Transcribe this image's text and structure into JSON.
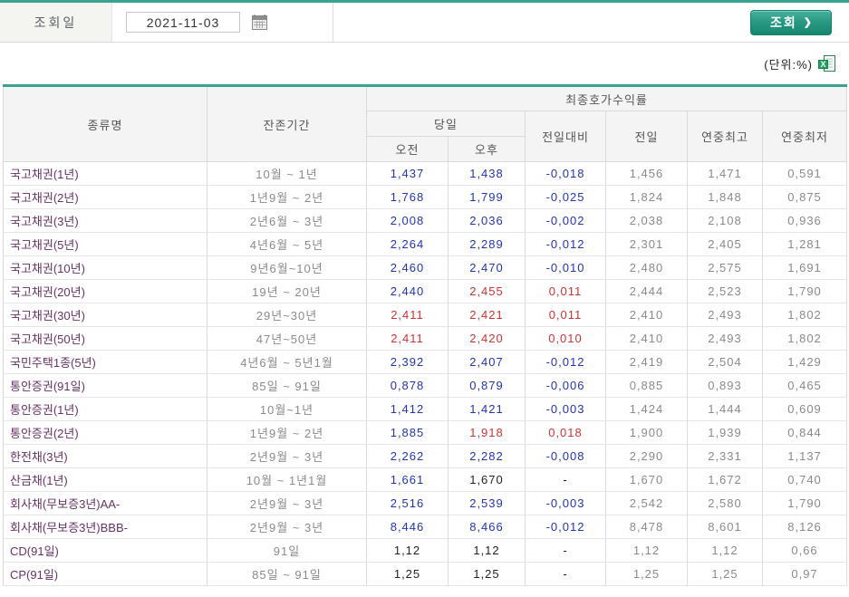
{
  "colors": {
    "teal": "#3aa390",
    "blue": "#2434ab",
    "red": "#cc3333",
    "gray": "#8a8a8a",
    "black": "#222222",
    "purple": "#663366"
  },
  "topbar": {
    "date_label": "조회일",
    "date_value": "2021-11-03",
    "calendar_icon": "calendar-icon",
    "search_button": "조회",
    "search_arrow": "❯"
  },
  "unit_label": "(단위:%)",
  "excel_icon": "excel-download-icon",
  "table": {
    "headers": {
      "name": "종류명",
      "term": "잔존기간",
      "yield_group": "최종호가수익률",
      "today": "당일",
      "am": "오전",
      "pm": "오후",
      "vs_prev": "전일대비",
      "prev": "전일",
      "year_high": "연중최고",
      "year_low": "연중최저"
    },
    "rows": [
      {
        "name": "국고채권(1년)",
        "term": "10월 ~ 1년",
        "am": "1,437",
        "am_color": "blue",
        "pm": "1,438",
        "pm_color": "blue",
        "change": "-0,018",
        "change_color": "blue",
        "prev": "1,456",
        "high": "1,471",
        "low": "0,591",
        "group_start": false
      },
      {
        "name": "국고채권(2년)",
        "term": "1년9월 ~ 2년",
        "am": "1,768",
        "am_color": "blue",
        "pm": "1,799",
        "pm_color": "blue",
        "change": "-0,025",
        "change_color": "blue",
        "prev": "1,824",
        "high": "1,848",
        "low": "0,875",
        "group_start": false
      },
      {
        "name": "국고채권(3년)",
        "term": "2년6월 ~ 3년",
        "am": "2,008",
        "am_color": "blue",
        "pm": "2,036",
        "pm_color": "blue",
        "change": "-0,002",
        "change_color": "blue",
        "prev": "2,038",
        "high": "2,108",
        "low": "0,936",
        "group_start": false
      },
      {
        "name": "국고채권(5년)",
        "term": "4년6월 ~ 5년",
        "am": "2,264",
        "am_color": "blue",
        "pm": "2,289",
        "pm_color": "blue",
        "change": "-0,012",
        "change_color": "blue",
        "prev": "2,301",
        "high": "2,405",
        "low": "1,281",
        "group_start": false
      },
      {
        "name": "국고채권(10년)",
        "term": "9년6월~10년",
        "am": "2,460",
        "am_color": "blue",
        "pm": "2,470",
        "pm_color": "blue",
        "change": "-0,010",
        "change_color": "blue",
        "prev": "2,480",
        "high": "2,575",
        "low": "1,691",
        "group_start": false
      },
      {
        "name": "국고채권(20년)",
        "term": "19년 ~ 20년",
        "am": "2,440",
        "am_color": "blue",
        "pm": "2,455",
        "pm_color": "red",
        "change": "0,011",
        "change_color": "red",
        "prev": "2,444",
        "high": "2,523",
        "low": "1,790",
        "group_start": false
      },
      {
        "name": "국고채권(30년)",
        "term": "29년~30년",
        "am": "2,411",
        "am_color": "red",
        "pm": "2,421",
        "pm_color": "red",
        "change": "0,011",
        "change_color": "red",
        "prev": "2,410",
        "high": "2,493",
        "low": "1,802",
        "group_start": false
      },
      {
        "name": "국고채권(50년)",
        "term": "47년~50년",
        "am": "2,411",
        "am_color": "red",
        "pm": "2,420",
        "pm_color": "red",
        "change": "0,010",
        "change_color": "red",
        "prev": "2,410",
        "high": "2,493",
        "low": "1,802",
        "group_start": false
      },
      {
        "name": "국민주택1종(5년)",
        "term": "4년6월 ~ 5년1월",
        "am": "2,392",
        "am_color": "blue",
        "pm": "2,407",
        "pm_color": "blue",
        "change": "-0,012",
        "change_color": "blue",
        "prev": "2,419",
        "high": "2,504",
        "low": "1,429",
        "group_start": false
      },
      {
        "name": "통안증권(91일)",
        "term": "85일 ~ 91일",
        "am": "0,878",
        "am_color": "blue",
        "pm": "0,879",
        "pm_color": "blue",
        "change": "-0,006",
        "change_color": "blue",
        "prev": "0,885",
        "high": "0,893",
        "low": "0,465",
        "group_start": true
      },
      {
        "name": "통안증권(1년)",
        "term": "10월~1년",
        "am": "1,412",
        "am_color": "blue",
        "pm": "1,421",
        "pm_color": "blue",
        "change": "-0,003",
        "change_color": "blue",
        "prev": "1,424",
        "high": "1,444",
        "low": "0,609",
        "group_start": false
      },
      {
        "name": "통안증권(2년)",
        "term": "1년9월 ~ 2년",
        "am": "1,885",
        "am_color": "blue",
        "pm": "1,918",
        "pm_color": "red",
        "change": "0,018",
        "change_color": "red",
        "prev": "1,900",
        "high": "1,939",
        "low": "0,844",
        "group_start": false
      },
      {
        "name": "한전채(3년)",
        "term": "2년9월 ~ 3년",
        "am": "2,262",
        "am_color": "blue",
        "pm": "2,282",
        "pm_color": "blue",
        "change": "-0,008",
        "change_color": "blue",
        "prev": "2,290",
        "high": "2,331",
        "low": "1,137",
        "group_start": true
      },
      {
        "name": "산금채(1년)",
        "term": "10월 ~ 1년1월",
        "am": "1,661",
        "am_color": "blue",
        "pm": "1,670",
        "pm_color": "black",
        "change": "-",
        "change_color": "black",
        "prev": "1,670",
        "high": "1,672",
        "low": "0,740",
        "group_start": false
      },
      {
        "name": "회사채(무보증3년)AA-",
        "term": "2년9월 ~ 3년",
        "am": "2,516",
        "am_color": "blue",
        "pm": "2,539",
        "pm_color": "blue",
        "change": "-0,003",
        "change_color": "blue",
        "prev": "2,542",
        "high": "2,580",
        "low": "1,790",
        "group_start": true
      },
      {
        "name": "회사채(무보증3년)BBB-",
        "term": "2년9월 ~ 3년",
        "am": "8,446",
        "am_color": "blue",
        "pm": "8,466",
        "pm_color": "blue",
        "change": "-0,012",
        "change_color": "blue",
        "prev": "8,478",
        "high": "8,601",
        "low": "8,126",
        "group_start": false
      },
      {
        "name": "CD(91일)",
        "term": "91일",
        "am": "1,12",
        "am_color": "black",
        "pm": "1,12",
        "pm_color": "black",
        "change": "-",
        "change_color": "black",
        "prev": "1,12",
        "high": "1,12",
        "low": "0,66",
        "group_start": true
      },
      {
        "name": "CP(91일)",
        "term": "85일 ~ 91일",
        "am": "1,25",
        "am_color": "black",
        "pm": "1,25",
        "pm_color": "black",
        "change": "-",
        "change_color": "black",
        "prev": "1,25",
        "high": "1,25",
        "low": "0,97",
        "group_start": false
      }
    ]
  }
}
